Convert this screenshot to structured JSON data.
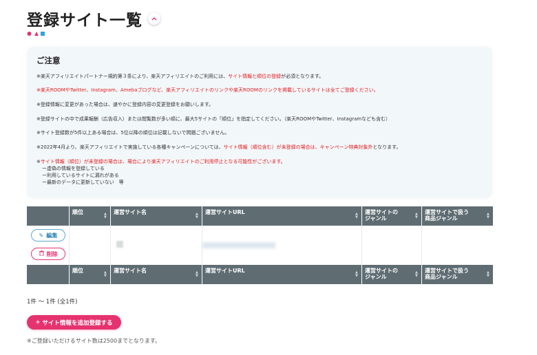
{
  "page": {
    "title": "登録サイト一覧",
    "toggle_icon": "^"
  },
  "notice": {
    "heading": "ご注意",
    "line1_a": "※楽天アフィリエイトパートナー規約第３条により、楽天アフィリエイトのご利用には、",
    "line1_red": "サイト情報と順位の登録",
    "line1_b": "が必須となります。",
    "line2_red": "※楽天ROOMやTwitter、Instagram、Amebaブログなど、楽天アフィリエイトのリンクや楽天ROOMのリンクを掲載しているサイトは全てご登録ください。",
    "line3": "※登録情報に変更があった場合は、速やかに登録内容の変更登録をお願いします。",
    "line4": "※登録サイトの中で成果報酬（広告収入）または閲覧数が多い順に、最大5サイトの「順位」を指定してください。（楽天ROOMやTwitter、Instagramなども含む）",
    "line5": "※サイト登録数が5件以上ある場合は、5位以降の順位は記載しないで問題ございません。",
    "line6_a": "※2022年4月より、楽天アフィリエイトで実施している各種キャンペーンについては、",
    "line6_red1": "サイト情報（順位含む）が未登録の場合は、キャンペーン特典対象外",
    "line6_b": "となります。",
    "line7_a": "※",
    "line7_red": "サイト情報（順位）が未登録の場合は、場合により楽天アフィリエイトのご利用停止となる可能性がございます。",
    "sub1": "ー虚偽の情報を登録している",
    "sub2": "ー利用しているサイトに漏れがある",
    "sub3": "ー最新のデータに更新していない　等"
  },
  "table": {
    "headers": [
      "",
      "順位",
      "運営サイト名",
      "運営サイトURL",
      "運営サイトの\nジャンル",
      "運営サイトで扱う\n商品ジャンル"
    ],
    "sort_icon": "▲▼",
    "edit_label": "編集",
    "delete_label": "削除",
    "edit_icon": "✎",
    "delete_icon": "🗑"
  },
  "pagination": {
    "count_text": "1件 〜 1件 (全1件)"
  },
  "actions": {
    "add_label": "サイト情報を追加登録する",
    "add_icon": "+"
  },
  "footnote": "※ご登録いただけるサイト数は2500までとなります。",
  "colors": {
    "accent": "#e5336f",
    "header_bg": "#5f6d73",
    "notice_bg": "#f2f7fa",
    "warning_red": "#e61919",
    "edit_blue": "#2f86b8",
    "deco_blue": "#2aa3e0"
  }
}
